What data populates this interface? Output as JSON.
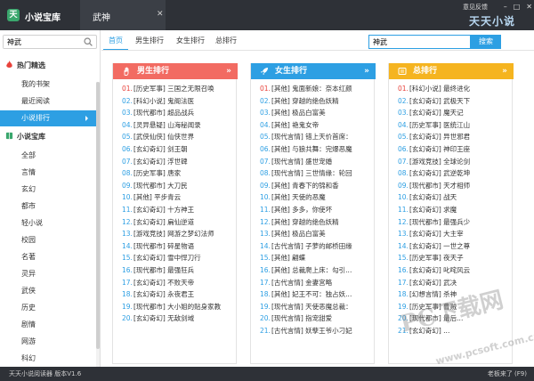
{
  "app": {
    "title": "小说宝库",
    "logo_char": "天"
  },
  "tab": {
    "title": "武神",
    "close": "✕"
  },
  "window": {
    "feedback": "意见反馈",
    "minimize": "–",
    "maximize": "□",
    "close": "✕",
    "brand": "天天小说"
  },
  "sidebar": {
    "search_value": "神武",
    "hot_title": "热门精选",
    "hot_items": [
      "我的书架",
      "最近阅读",
      "小说排行"
    ],
    "active_item": "小说排行",
    "library_title": "小说宝库",
    "library_items": [
      "全部",
      "言情",
      "玄幻",
      "都市",
      "轻小说",
      "校园",
      "名著",
      "灵异",
      "武侠",
      "历史",
      "剧情",
      "网游",
      "科幻"
    ]
  },
  "main": {
    "tabs": [
      "首页",
      "男生排行",
      "女生排行",
      "总排行"
    ],
    "active_tab": "首页",
    "search_value": "神武",
    "search_button": "搜索"
  },
  "colors": {
    "accent": "#2d9fe3",
    "male": "#f26b62",
    "female": "#2d9fe3",
    "total": "#f5b420",
    "titlebar": "#2e3137"
  },
  "panels": [
    {
      "title": "男生排行",
      "more": "»",
      "icon": "hand-icon",
      "items": [
        "[历史军事] 三国之无限召唤",
        "[科幻小说] 鬼阁法医",
        "[现代都市] 超品战兵",
        "[灵异悬疑] 山海秘闻录",
        "[武侠仙侠] 仙侠世界",
        "[玄幻奇幻] 剑王朝",
        "[玄幻奇幻] 浮世碑",
        "[历史军事] 唐家",
        "[现代都市] 大刀民",
        "[其他] 平步青云",
        "[玄幻奇幻] 十方神王",
        "[玄幻奇幻] 扁仙逆道",
        "[游戏竞技] 网游之梦幻法师",
        "[现代都市] 碎星物语",
        "[玄幻奇幻] 雪中悍刀行",
        "[现代都市] 最强狂兵",
        "[玄幻奇幻] 不败天帝",
        "[玄幻奇幻] 永夜君王",
        "[现代都市] 大小姐的贴身家教",
        "[玄幻奇幻] 无敌剑域"
      ]
    },
    {
      "title": "女生排行",
      "more": "»",
      "icon": "rocket-icon",
      "items": [
        "[其他] 鬼面新娘：奈本红颜",
        "[其他] 穿越的绝色妖精",
        "[其他] 极品白富美",
        "[其他] 艳鬼女帝",
        "[现代言情] 错上天价首席：",
        "[其他] 与狼共舞：完爆恶魔",
        "[现代言情] 盛世宠婚",
        "[现代言情] 三世情缘：轮回",
        "[其他] 青春下的锦和香",
        "[其他] 天使的恶魔",
        "[其他] 多多，你使坏",
        "[其他] 穿越的绝色妖精",
        "[其他] 极品白富美",
        "[古代言情] 子萝的邮桥田缘",
        "[其他] 翩蝶",
        "[其他] 总裁爬上床：勾引...",
        "[古代言情] 金妻宫略",
        "[其他] 妃王不可：独占妖...",
        "[现代言情] 天使恶魔总裁：",
        "[现代言情] 指宠甜爱",
        "[古代言情] 妖孽王爷小刁妃"
      ]
    },
    {
      "title": "总排行",
      "more": "»",
      "icon": "crown-icon",
      "items": [
        "[科幻小说] 最终进化",
        "[玄幻奇幻] 武极天下",
        "[玄幻奇幻] 魔天记",
        "[历史军事] 医统江山",
        "[玄幻奇幻] 异世邪君",
        "[玄幻奇幻] 神印王座",
        "[游戏竞技] 全球论剑",
        "[玄幻奇幻] 武逆乾坤",
        "[现代都市] 天才相师",
        "[玄幻奇幻] 战天",
        "[玄幻奇幻] 求魔",
        "[现代都市] 最强兵少",
        "[玄幻奇幻] 大主宰",
        "[玄幻奇幻] 一世之尊",
        "[历史军事] 夜天子",
        "[玄幻奇幻] 叱咤风云",
        "[玄幻奇幻] 武决",
        "[幻想言情] 杀神",
        "[历史军事] 曹贼",
        "[现代都市] 最后...",
        "[玄幻奇幻] ..."
      ]
    }
  ],
  "status": {
    "left": "天天小说阅读器  版本V1.6",
    "right": "老板来了 (F9)"
  },
  "watermark": {
    "line1": "PC下载网",
    "line2": "www.pcsoft.com.cn"
  }
}
